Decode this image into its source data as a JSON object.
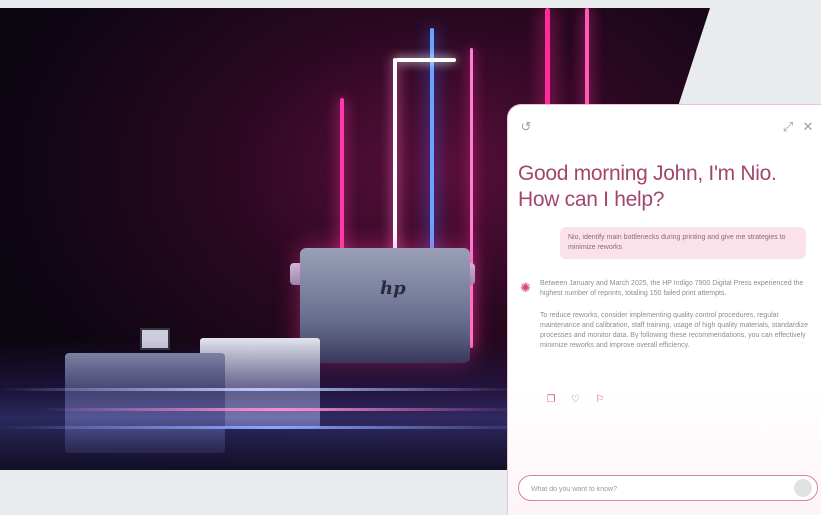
{
  "assistant": {
    "greeting": "Good morning John, I'm Nio. How can I help?",
    "user_message": "Nio, identify main bottlenecks during printing and give me strategies to minimize reworks",
    "response_paragraphs": [
      "Between January and March 2025, the HP Indigo 7900 Digital Press experienced the highest number of reprints, totaling 150 failed print attempts.",
      "To reduce reworks, consider implementing quality control procedures, regular maintenance and calibration, staff training, usage of high quality materials, standardize processes and monitor data. By following these recommendations, you can effectively minimize reworks and improve overall efficiency."
    ],
    "input_placeholder": "What do you want to know?",
    "icons": {
      "history": "history-icon",
      "expand": "expand-icon",
      "close": "close-icon",
      "avatar": "spark-icon",
      "copy": "copy-icon",
      "thumbs_up": "thumbs-up-icon",
      "thumbs_down": "thumbs-down-icon",
      "send": "send-icon"
    }
  },
  "hero": {
    "brand_mark": "hp",
    "accent_colors": [
      "#ff2d9a",
      "#3c6bff",
      "#a4456e"
    ]
  }
}
